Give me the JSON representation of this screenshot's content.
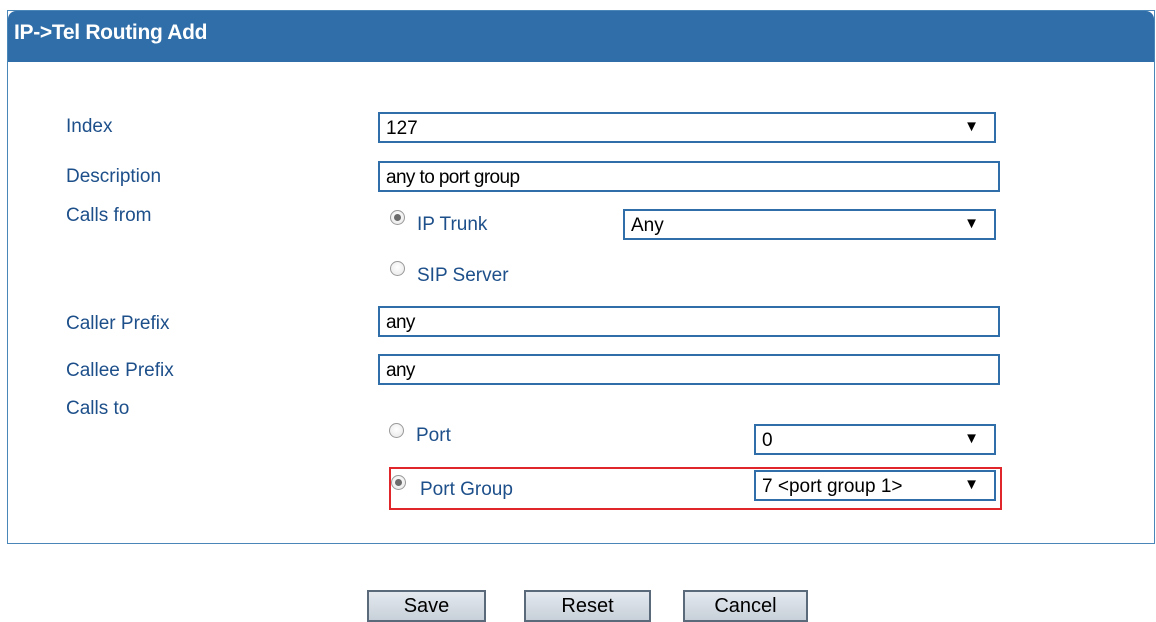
{
  "header": {
    "title": "IP->Tel Routing Add"
  },
  "fields": {
    "index": {
      "label": "Index",
      "value": "127"
    },
    "description": {
      "label": "Description",
      "value": "any to port group"
    },
    "calls_from": {
      "label": "Calls from",
      "ip_trunk": {
        "label": "IP Trunk",
        "selected": true,
        "value": "Any"
      },
      "sip_server": {
        "label": "SIP Server",
        "selected": false
      }
    },
    "caller_prefix": {
      "label": "Caller Prefix",
      "value": "any"
    },
    "callee_prefix": {
      "label": "Callee Prefix",
      "value": "any"
    },
    "calls_to": {
      "label": "Calls to",
      "port": {
        "label": "Port",
        "selected": false,
        "value": "0"
      },
      "port_group": {
        "label": "Port Group",
        "selected": true,
        "value": "7 <port group 1>"
      }
    }
  },
  "buttons": {
    "save": "Save",
    "reset": "Reset",
    "cancel": "Cancel"
  },
  "icons": {
    "dropdown": "triangle-down-icon",
    "radio": "radio-icon"
  },
  "colors": {
    "header": "#2f6ea8",
    "label": "#1d4f8a",
    "highlight": "#e0262b"
  }
}
